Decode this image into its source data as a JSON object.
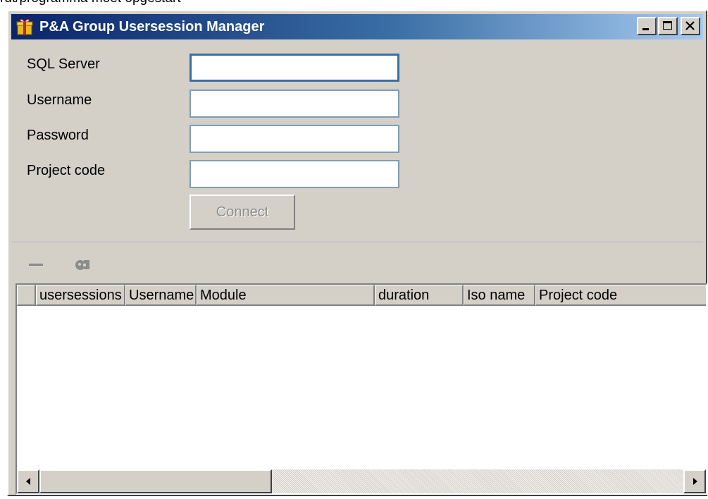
{
  "caption": "rdt/programma moet opgestart",
  "window": {
    "title": "P&A Group Usersession Manager",
    "buttons": [
      "minimize",
      "maximize",
      "close"
    ]
  },
  "form": {
    "labels": {
      "sql_server": "SQL Server",
      "username": "Username",
      "password": "Password",
      "project_code": "Project code"
    },
    "values": {
      "sql_server": "",
      "username": "",
      "password": "",
      "project_code": ""
    },
    "connect_label": "Connect",
    "connect_enabled": false
  },
  "toolbar": {
    "icons": [
      "minus-icon",
      "plug-icon"
    ],
    "enabled": false
  },
  "grid": {
    "columns": [
      "usersessions",
      "Username",
      "Module",
      "duration",
      "Iso name",
      "Project code"
    ],
    "rows": []
  },
  "colors": {
    "title_gradient_start": "#0a246a",
    "title_gradient_end": "#a6caf0",
    "window_face": "#d4d0c8",
    "disabled_text": "#8c8c8c"
  }
}
